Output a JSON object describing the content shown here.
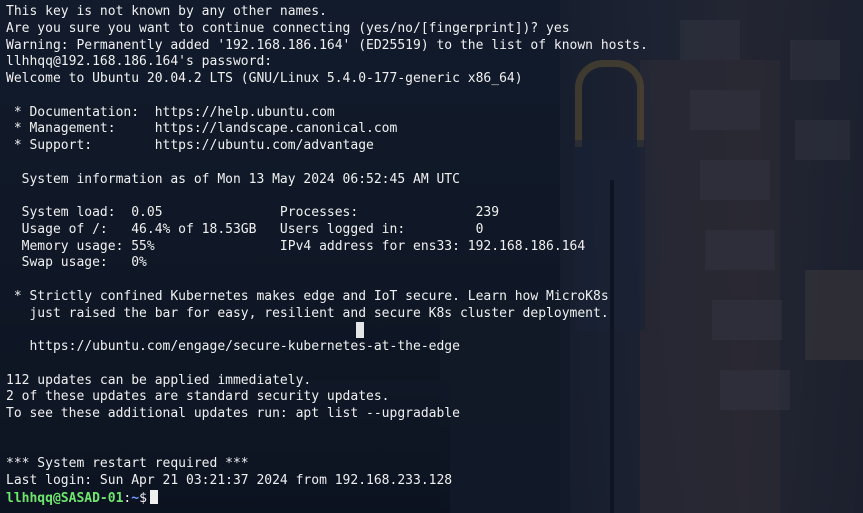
{
  "terminal": {
    "lines": [
      "This key is not known by any other names.",
      "Are you sure you want to continue connecting (yes/no/[fingerprint])? yes",
      "Warning: Permanently added '192.168.186.164' (ED25519) to the list of known hosts.",
      "llhhqq@192.168.186.164's password:",
      "Welcome to Ubuntu 20.04.2 LTS (GNU/Linux 5.4.0-177-generic x86_64)",
      "",
      " * Documentation:  https://help.ubuntu.com",
      " * Management:     https://landscape.canonical.com",
      " * Support:        https://ubuntu.com/advantage",
      "",
      "  System information as of Mon 13 May 2024 06:52:45 AM UTC",
      "",
      "  System load:  0.05               Processes:               239",
      "  Usage of /:   46.4% of 18.53GB   Users logged in:         0",
      "  Memory usage: 55%                IPv4 address for ens33: 192.168.186.164",
      "  Swap usage:   0%",
      "",
      " * Strictly confined Kubernetes makes edge and IoT secure. Learn how MicroK8s",
      "   just raised the bar for easy, resilient and secure K8s cluster deployment.",
      "",
      "   https://ubuntu.com/engage/secure-kubernetes-at-the-edge",
      "",
      "112 updates can be applied immediately.",
      "2 of these updates are standard security updates.",
      "To see these additional updates run: apt list --upgradable",
      "",
      "",
      "*** System restart required ***",
      "Last login: Sun Apr 21 03:21:37 2024 from 192.168.233.128"
    ],
    "prompt": {
      "user_host": "llhhqq@SASAD-01",
      "separator": ":",
      "path": "~",
      "symbol": "$"
    }
  },
  "colors": {
    "text": "#f0f0f0",
    "prompt_user": "#6ee66e",
    "prompt_path": "#6f9cff"
  }
}
